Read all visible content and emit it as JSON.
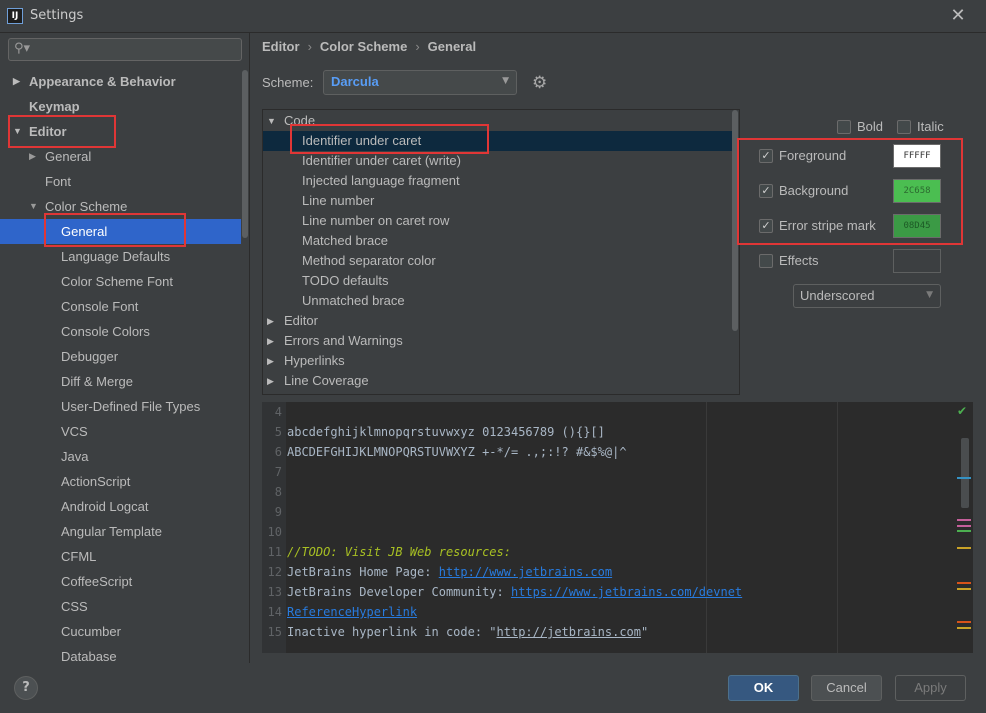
{
  "window": {
    "title": "Settings",
    "app_icon": "IJ"
  },
  "colors": {
    "selection": "#2f65ca",
    "annotation": "#e03636",
    "scheme_value": "#589df6"
  },
  "sidebar": {
    "search_placeholder": "",
    "items": [
      {
        "label": "Appearance & Behavior",
        "level": 0,
        "expandable": true,
        "expanded": false,
        "bold": true
      },
      {
        "label": "Keymap",
        "level": 0,
        "expandable": false,
        "bold": true
      },
      {
        "label": "Editor",
        "level": 0,
        "expandable": true,
        "expanded": true,
        "bold": true
      },
      {
        "label": "General",
        "level": 1,
        "expandable": true,
        "expanded": false
      },
      {
        "label": "Font",
        "level": 1,
        "expandable": false
      },
      {
        "label": "Color Scheme",
        "level": 1,
        "expandable": true,
        "expanded": true
      },
      {
        "label": "General",
        "level": 2,
        "selected": true
      },
      {
        "label": "Language Defaults",
        "level": 2
      },
      {
        "label": "Color Scheme Font",
        "level": 2
      },
      {
        "label": "Console Font",
        "level": 2
      },
      {
        "label": "Console Colors",
        "level": 2
      },
      {
        "label": "Debugger",
        "level": 2
      },
      {
        "label": "Diff & Merge",
        "level": 2
      },
      {
        "label": "User-Defined File Types",
        "level": 2
      },
      {
        "label": "VCS",
        "level": 2
      },
      {
        "label": "Java",
        "level": 2
      },
      {
        "label": "ActionScript",
        "level": 2
      },
      {
        "label": "Android Logcat",
        "level": 2
      },
      {
        "label": "Angular Template",
        "level": 2
      },
      {
        "label": "CFML",
        "level": 2
      },
      {
        "label": "CoffeeScript",
        "level": 2
      },
      {
        "label": "CSS",
        "level": 2
      },
      {
        "label": "Cucumber",
        "level": 2
      },
      {
        "label": "Database",
        "level": 2
      }
    ]
  },
  "breadcrumb": {
    "part1": "Editor",
    "part2": "Color Scheme",
    "part3": "General",
    "separator": "›"
  },
  "scheme": {
    "label": "Scheme:",
    "value": "Darcula"
  },
  "attributes": {
    "items": [
      {
        "label": "Code",
        "type": "group",
        "expanded": true
      },
      {
        "label": "Identifier under caret",
        "type": "leaf",
        "selected": true
      },
      {
        "label": "Identifier under caret (write)",
        "type": "leaf"
      },
      {
        "label": "Injected language fragment",
        "type": "leaf"
      },
      {
        "label": "Line number",
        "type": "leaf"
      },
      {
        "label": "Line number on caret row",
        "type": "leaf"
      },
      {
        "label": "Matched brace",
        "type": "leaf"
      },
      {
        "label": "Method separator color",
        "type": "leaf"
      },
      {
        "label": "TODO defaults",
        "type": "leaf"
      },
      {
        "label": "Unmatched brace",
        "type": "leaf"
      },
      {
        "label": "Editor",
        "type": "group",
        "expanded": false
      },
      {
        "label": "Errors and Warnings",
        "type": "group",
        "expanded": false
      },
      {
        "label": "Hyperlinks",
        "type": "group",
        "expanded": false
      },
      {
        "label": "Line Coverage",
        "type": "group",
        "expanded": false
      }
    ]
  },
  "options": {
    "bold": {
      "label": "Bold",
      "checked": false
    },
    "italic": {
      "label": "Italic",
      "checked": false
    },
    "foreground": {
      "label": "Foreground",
      "checked": true,
      "value": "FFFFF",
      "color": "#ffffff",
      "text_color": "#333333"
    },
    "background": {
      "label": "Background",
      "checked": true,
      "value": "2C658",
      "color": "#4bbe51",
      "text_color": "#2c6a30"
    },
    "error_stripe": {
      "label": "Error stripe mark",
      "checked": true,
      "value": "08D45",
      "color": "#3b9a45",
      "text_color": "#1d5a26"
    },
    "effects": {
      "label": "Effects",
      "checked": false,
      "style": "Underscored"
    }
  },
  "preview": {
    "lines": [
      {
        "num": "4",
        "segments": []
      },
      {
        "num": "5",
        "segments": [
          {
            "text": "abcdefghijklmnopqrstuvwxyz 0123456789 (){}[]",
            "cls": ""
          }
        ]
      },
      {
        "num": "6",
        "segments": [
          {
            "text": "ABCDEFGHIJKLMNOPQRSTUVWXYZ +-*/= .,;:!? #&$%@|^",
            "cls": ""
          }
        ]
      },
      {
        "num": "7",
        "segments": []
      },
      {
        "num": "8",
        "segments": []
      },
      {
        "num": "9",
        "segments": []
      },
      {
        "num": "10",
        "segments": []
      },
      {
        "num": "11",
        "segments": [
          {
            "text": "//",
            "cls": "todo"
          },
          {
            "text": "TODO: Visit JB Web resources:",
            "cls": "todo"
          }
        ]
      },
      {
        "num": "12",
        "segments": [
          {
            "text": "JetBrains Home Page: ",
            "cls": ""
          },
          {
            "text": "http://www.jetbrains.com",
            "cls": "link"
          }
        ]
      },
      {
        "num": "13",
        "segments": [
          {
            "text": "JetBrains Developer Community: ",
            "cls": ""
          },
          {
            "text": "https://www.jetbrains.com/devnet",
            "cls": "link"
          }
        ]
      },
      {
        "num": "14",
        "segments": [
          {
            "text": "ReferenceHyperlink",
            "cls": "link"
          }
        ]
      },
      {
        "num": "15",
        "segments": [
          {
            "text": "Inactive hyperlink in code: \"",
            "cls": ""
          },
          {
            "text": "http://jetbrains.com",
            "cls": "inactive"
          },
          {
            "text": "\"",
            "cls": ""
          }
        ]
      }
    ]
  },
  "footer": {
    "help": "?",
    "ok": "OK",
    "cancel": "Cancel",
    "apply": "Apply"
  }
}
